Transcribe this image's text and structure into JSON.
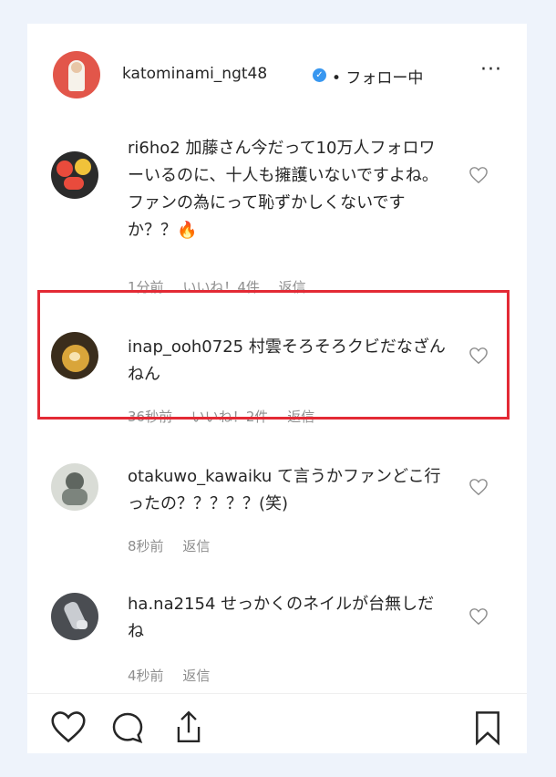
{
  "header": {
    "username": "katominami_ngt48",
    "verified_mark": "✓",
    "follow_status": "• フォロー中",
    "more_label": "···"
  },
  "comments": [
    {
      "username": "ri6ho2",
      "text": "加藤さん今だって10万人フォロワーいるのに、十人も擁護いないですよね。ファンの為にって恥ずかしくないですか？？🔥",
      "time": "1分前",
      "likes": "いいね！4件",
      "reply": "返信"
    },
    {
      "username": "inap_ooh0725",
      "text": "村雲そろそろクビだなざんねん",
      "time": "36秒前",
      "likes": "いいね！2件",
      "reply": "返信"
    },
    {
      "username": "otakuwo_kawaiku",
      "text": "て言うかファンどこ行ったの？？？？？(笑)",
      "time": "8秒前",
      "reply": "返信"
    },
    {
      "username": "ha.na2154",
      "text": "せっかくのネイルが台無しだね",
      "time": "4秒前",
      "reply": "返信"
    }
  ],
  "colors": {
    "highlight": "#e32a35",
    "verified": "#3897f0",
    "meta_text": "#8e8e8e",
    "background": "#eef3fb"
  },
  "footer_icons": [
    "heart-icon",
    "comment-icon",
    "share-icon",
    "bookmark-icon"
  ]
}
